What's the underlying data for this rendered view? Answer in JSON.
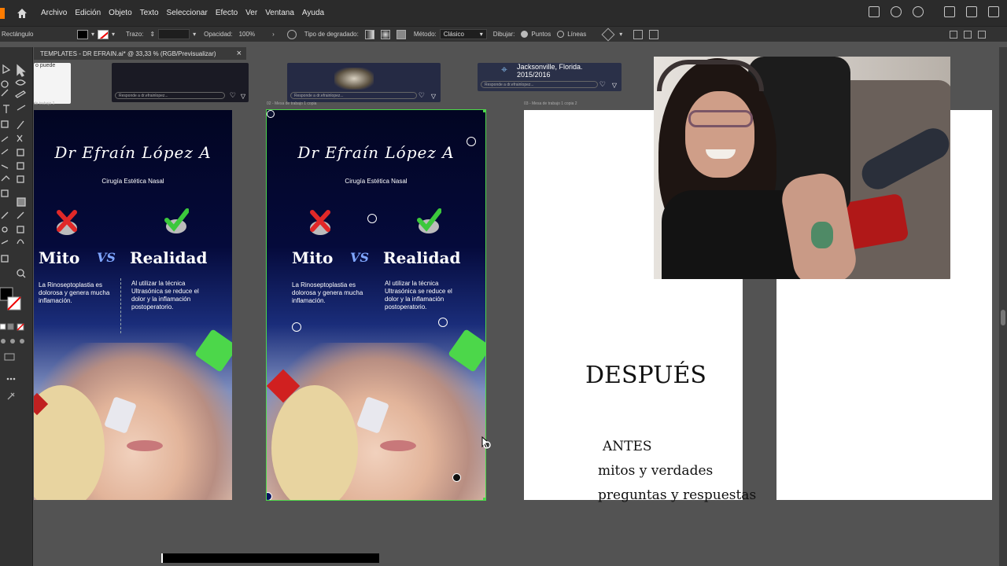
{
  "menu": {
    "items": [
      "Archivo",
      "Edición",
      "Objeto",
      "Texto",
      "Seleccionar",
      "Efecto",
      "Ver",
      "Ventana",
      "Ayuda"
    ]
  },
  "control_bar": {
    "tool_name": "Rectángulo",
    "stroke_label": "Trazo:",
    "opacity_label": "Opacidad:",
    "opacity_value": "100%",
    "gradient_label": "Tipo de degradado:",
    "method_label": "Método:",
    "method_value": "Clásico",
    "draw_label": "Dibujar:",
    "draw_points": "Puntos",
    "draw_lines": "Líneas"
  },
  "document": {
    "tab_title": "TEMPLATES - DR EFRAIN.ai* @ 33,33 % (RGB/Previsualizar)",
    "close": "×"
  },
  "thumbnails": {
    "top_left_text": "o puede",
    "bar_text_1": "Responde a dr.efrainlopez...",
    "bar_text_2": "Responde a dr.efrainlopez...",
    "bar_text_3": "Responde a dr.efrainlopez...",
    "third_text": "Jacksonville, Florida. 2015/2016"
  },
  "artboards": {
    "label_1": "de trabajo 1",
    "label_2": "02 - Mesa de trabajo 1 copia",
    "label_3": "03 - Mesa de trabajo 1 copia 2"
  },
  "poster": {
    "signature": "Dr Efraín López A",
    "subtitle": "Cirugía Estética Nasal",
    "mito": "Mito",
    "vs": "VS",
    "realidad": "Realidad",
    "left_text": "La Rinoseptoplastia es dolorosa y genera mucha inflamación.",
    "right_text": "Al utilizar la técnica Ultrasónica se reduce el dolor y la inflamación postoperatorio."
  },
  "white_board": {
    "despues": "DESPUÉS",
    "antes": "ANTES",
    "mitos": "mitos y verdades",
    "preguntas": "preguntas y respuestas"
  },
  "colors": {
    "accent_green": "#4cd74a",
    "app_dark": "#2b2b2b",
    "canvas": "#535353"
  }
}
